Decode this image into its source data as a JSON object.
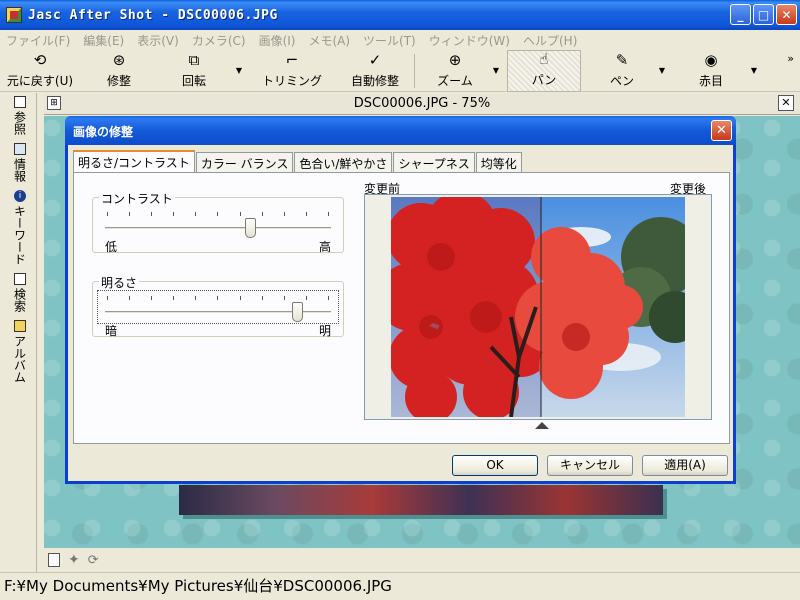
{
  "window": {
    "title": "Jasc After Shot - DSC00006.JPG",
    "min": "_",
    "max": "□",
    "close": "✕"
  },
  "menu": [
    "ファイル(F)",
    "編集(E)",
    "表示(V)",
    "カメラ(C)",
    "画像(I)",
    "メモ(A)",
    "ツール(T)",
    "ウィンドウ(W)",
    "ヘルプ(H)"
  ],
  "toolbar": {
    "undo": "元に戻す(U)",
    "repair": "修整",
    "rotate": "回転",
    "trim": "トリミング",
    "auto_repair": "自動修整",
    "zoom": "ズーム",
    "pan": "パン",
    "pen": "ペン",
    "redeye": "赤目",
    "more": "»"
  },
  "side_tabs": [
    "参照",
    "情報",
    "キーワード",
    "検索",
    "アルバム"
  ],
  "doc": {
    "title": "DSC00006.JPG - 75%",
    "close": "✕",
    "pin": "⊞"
  },
  "dialog": {
    "title": "画像の修整",
    "close": "✕",
    "tabs": [
      "明るさ/コントラスト",
      "カラー バランス",
      "色合い/鮮やかさ",
      "シャープネス",
      "均等化"
    ],
    "contrast": {
      "label": "コントラスト",
      "low": "低",
      "high": "高",
      "value": 0.65
    },
    "brightness": {
      "label": "明るさ",
      "low": "暗",
      "high": "明",
      "value": 0.87
    },
    "preview_before": "変更前",
    "preview_after": "変更後",
    "ok": "OK",
    "cancel": "キャンセル",
    "apply": "適用(A)"
  },
  "status": {
    "path": "F:¥My Documents¥My Pictures¥仙台¥DSC00006.JPG"
  }
}
